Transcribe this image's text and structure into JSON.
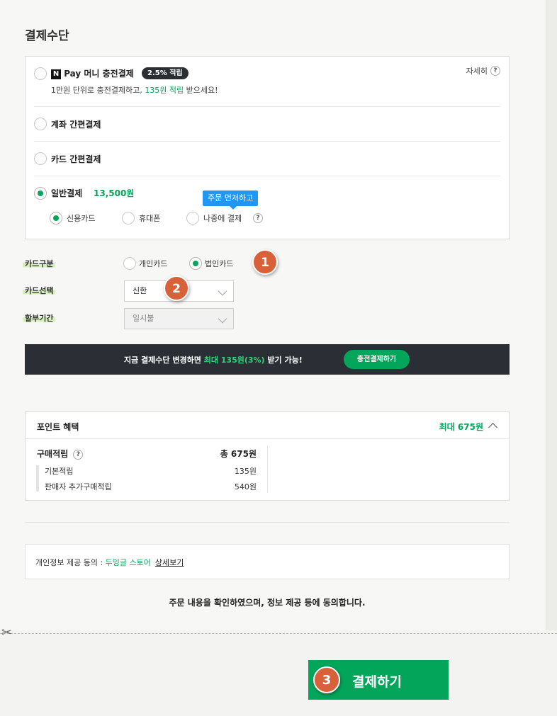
{
  "section_title": "결제수단",
  "methods": {
    "npay": {
      "logo": "N",
      "label": "Pay 머니 충전결제",
      "badge": "2.5% 적립",
      "detail": "자세히",
      "desc_prefix": "1만원 단위로 충전결제하고, ",
      "desc_highlight": "135원 적립",
      "desc_suffix": " 받으세요!"
    },
    "account": {
      "label": "계좌 간편결제"
    },
    "card": {
      "label": "카드 간편결제"
    },
    "general": {
      "label": "일반결제",
      "amount": "13,500원",
      "options": {
        "credit": "신용카드",
        "phone": "휴대폰",
        "later": "나중에 결제"
      },
      "tooltip": "주문 먼저하고"
    }
  },
  "card_form": {
    "type_label": "카드구분",
    "type_personal": "개인카드",
    "type_corporate": "법인카드",
    "select_label": "카드선택",
    "select_value": "신한",
    "installment_label": "할부기간",
    "installment_value": "일시불"
  },
  "steps": {
    "one": "1",
    "two": "2",
    "three": "3"
  },
  "promo": {
    "prefix": "지금 결제수단 변경하면 ",
    "highlight": "최대 135원(3%)",
    "suffix": " 받기 가능!",
    "button": "충전결제하기"
  },
  "points": {
    "title": "포인트 혜택",
    "max": "최대 675원",
    "purchase_label": "구매적립",
    "purchase_total": "총 675원",
    "basic_label": "기본적립",
    "basic_value": "135원",
    "seller_label": "판매자 추가구매적립",
    "seller_value": "540원"
  },
  "consent": {
    "prefix": "개인정보 제공 동의 : ",
    "store": "두잉글 스토어",
    "link": "상세보기"
  },
  "agree_text": "주문 내용을 확인하였으며, 정보 제공 등에 동의합니다.",
  "pay_button": "결제하기",
  "colors": {
    "accent": "#03a55a",
    "step": "#d9613a",
    "tooltip": "#2196f3",
    "promo_bg": "#2b2f35"
  }
}
